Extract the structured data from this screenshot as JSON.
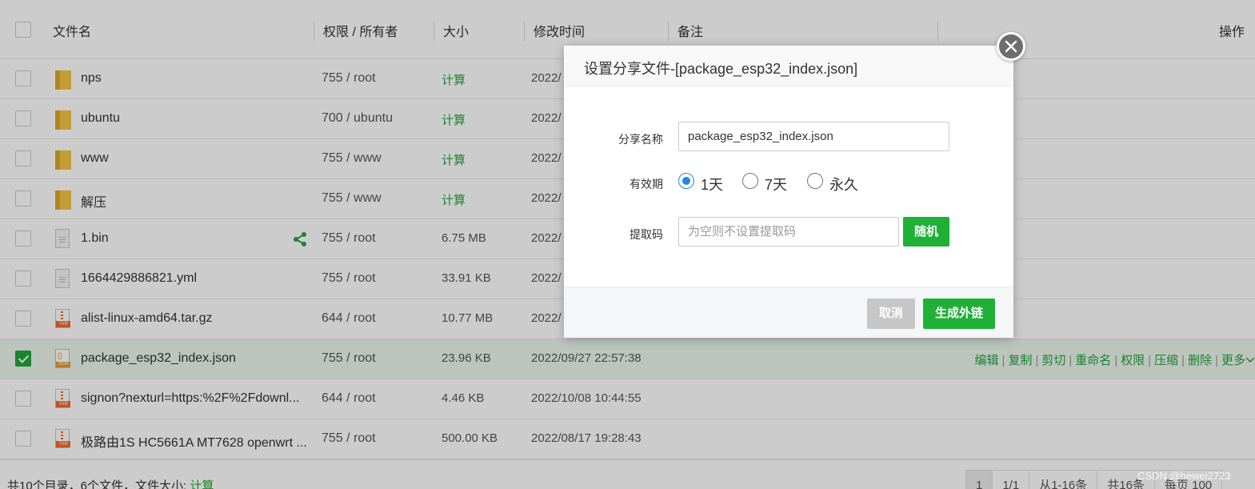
{
  "table": {
    "header": {
      "name": "文件名",
      "perm": "权限 / 所有者",
      "size": "大小",
      "mtime": "修改时间",
      "note": "备注",
      "ops": "操作"
    },
    "rows": [
      {
        "name": "nps",
        "perm": "755 / root",
        "size": "计算",
        "mtime": "2022/",
        "type": "folder"
      },
      {
        "name": "ubuntu",
        "perm": "700 / ubuntu",
        "size": "计算",
        "mtime": "2022/",
        "type": "folder"
      },
      {
        "name": "www",
        "perm": "755 / www",
        "size": "计算",
        "mtime": "2022/",
        "type": "folder"
      },
      {
        "name": "解压",
        "perm": "755 / www",
        "size": "计算",
        "mtime": "2022/",
        "type": "folder"
      },
      {
        "name": "1.bin",
        "perm": "755 / root",
        "size": "6.75 MB",
        "mtime": "2022/",
        "type": "doc"
      },
      {
        "name": "1664429886821.yml",
        "perm": "755 / root",
        "size": "33.91 KB",
        "mtime": "2022/",
        "type": "doc"
      },
      {
        "name": "alist-linux-amd64.tar.gz",
        "perm": "644 / root",
        "size": "10.77 MB",
        "mtime": "2022/",
        "type": "tar"
      },
      {
        "name": "package_esp32_index.json",
        "perm": "755 / root",
        "size": "23.96 KB",
        "mtime": "2022/09/27 22:57:38",
        "type": "json",
        "selected": true
      },
      {
        "name": "signon?nexturl=https:%2F%2Fdownl...",
        "perm": "644 / root",
        "size": "4.46 KB",
        "mtime": "2022/10/08 10:44:55",
        "type": "tar"
      },
      {
        "name": "极路由1S HC5661A MT7628 openwrt ...",
        "perm": "755 / root",
        "size": "500.00 KB",
        "mtime": "2022/08/17 19:28:43",
        "type": "tar"
      }
    ],
    "ops": [
      "编辑",
      "复制",
      "剪切",
      "重命名",
      "权限",
      "压缩",
      "删除",
      "更多"
    ],
    "tar_badge": "TAR",
    "json_badge": "JSON"
  },
  "footer": {
    "summary": "共10个目录，6个文件，文件大小: ",
    "summary_calc": "计算",
    "pager": [
      "1",
      "1/1",
      "从1-16条",
      "共16条",
      "每页",
      "100"
    ]
  },
  "modal": {
    "title": "设置分享文件-[package_esp32_index.json]",
    "name_label": "分享名称",
    "name_value": "package_esp32_index.json",
    "expire_label": "有效期",
    "expire_options": [
      "1天",
      "7天",
      "永久"
    ],
    "expire_selected": "1天",
    "code_label": "提取码",
    "code_placeholder": "为空则不设置提取码",
    "random_label": "随机",
    "cancel_label": "取消",
    "generate_label": "生成外链"
  },
  "watermark": "CSDN @hewei2723",
  "colors": {
    "accent_green": "#20a53a",
    "button_green": "#20b038",
    "radio_blue": "#1e88e5"
  }
}
